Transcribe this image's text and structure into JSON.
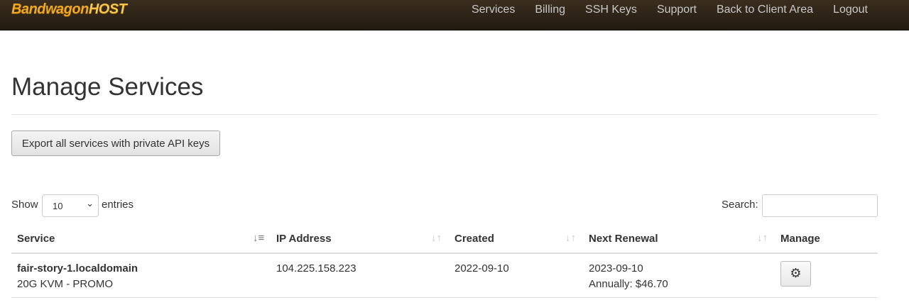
{
  "brand": {
    "part1": "Bandwagon",
    "part2": "HOST"
  },
  "nav": {
    "items": [
      "Services",
      "Billing",
      "SSH Keys",
      "Support",
      "Back to Client Area",
      "Logout"
    ]
  },
  "page": {
    "title": "Manage Services",
    "export_button": "Export all services with private API keys"
  },
  "table_controls": {
    "show_label": "Show",
    "entries_value": "10",
    "entries_label": "entries",
    "search_label": "Search:",
    "search_value": ""
  },
  "table": {
    "columns": [
      "Service",
      "IP Address",
      "Created",
      "Next Renewal",
      "Manage"
    ],
    "rows": [
      {
        "service_name": "fair-story-1.localdomain",
        "service_plan": "20G KVM - PROMO",
        "ip": "104.225.158.223",
        "created": "2022-09-10",
        "renewal_date": "2023-09-10",
        "renewal_price": "Annually: $46.70"
      }
    ]
  },
  "icons": {
    "sort_desc": "sort-descending-icon",
    "sort": "sort-icon",
    "gear": "gear-icon",
    "chevron": "chevron-down-icon"
  },
  "colors": {
    "navbar": "#2e2418",
    "brand": "#f0a820",
    "nav_text": "#c8c8c8"
  }
}
